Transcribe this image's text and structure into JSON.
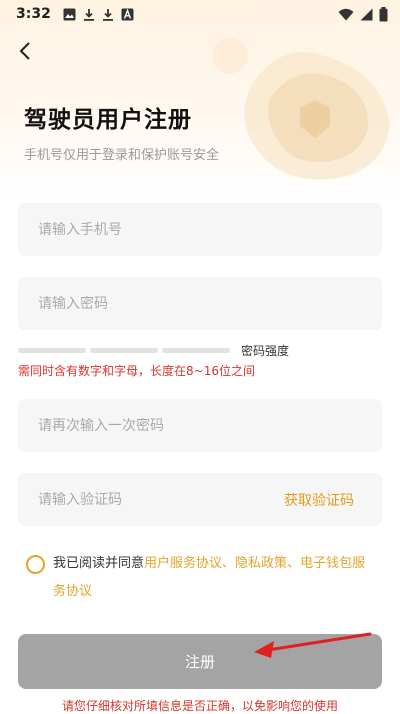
{
  "status_bar": {
    "time": "3:32",
    "icons_left": [
      "image-icon",
      "download-icon",
      "download-icon",
      "font-a-icon"
    ],
    "icons_right": [
      "wifi-icon",
      "signal-icon",
      "battery-icon"
    ]
  },
  "header": {
    "title": "驾驶员用户注册",
    "subtitle": "手机号仅用于登录和保护账号安全"
  },
  "form": {
    "phone_placeholder": "请输入手机号",
    "password_placeholder": "请输入密码",
    "strength_label": "密码强度",
    "password_hint": "需同时含有数字和字母，长度在8~16位之间",
    "confirm_placeholder": "请再次输入一次密码",
    "code_placeholder": "请输入验证码",
    "get_code_label": "获取验证码"
  },
  "agreement": {
    "prefix": "我已阅读并同意",
    "link1": "用户服务协议",
    "sep1": "、",
    "link2": "隐私政策",
    "sep2": "、",
    "link3": "电子钱包服务协议"
  },
  "submit_label": "注册",
  "footer_note": "请您仔细核对所填信息是否正确，以免影响您的使用",
  "colors": {
    "accent": "#e6a32a",
    "warning": "#d9342a",
    "button_disabled": "#a4a4a4",
    "annotation_arrow": "#e02020"
  }
}
